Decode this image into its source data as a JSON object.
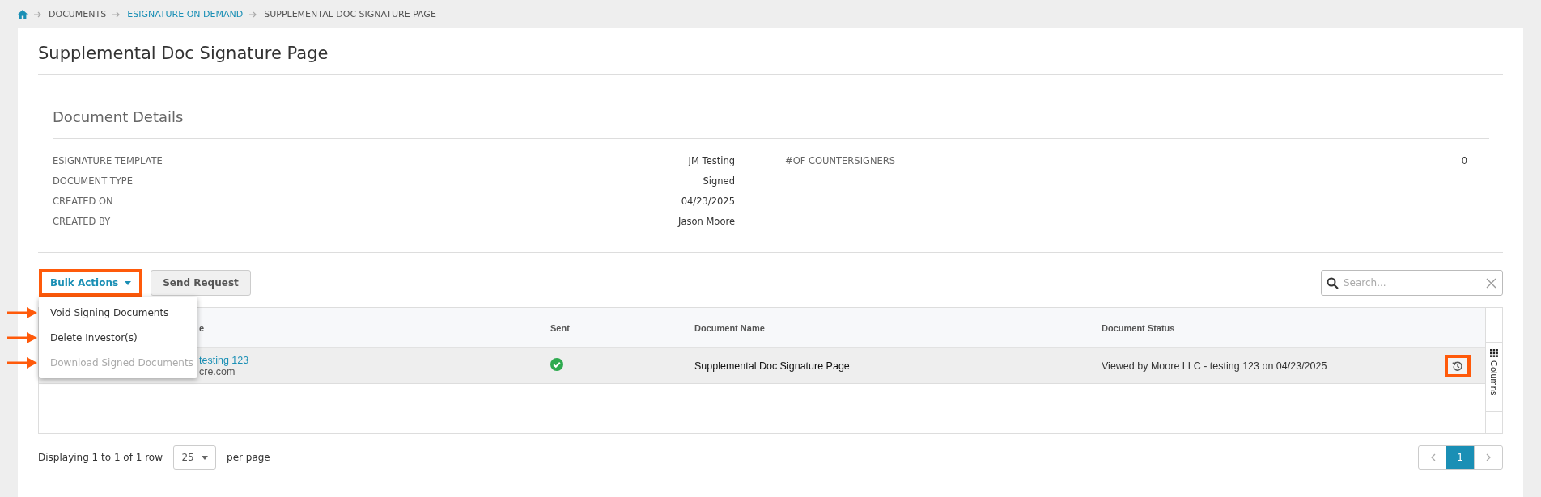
{
  "breadcrumb": [
    {
      "label": "DOCUMENTS",
      "link": false
    },
    {
      "label": "ESIGNATURE ON DEMAND",
      "link": true
    },
    {
      "label": "SUPPLEMENTAL DOC SIGNATURE PAGE",
      "link": false
    }
  ],
  "page_title": "Supplemental Doc Signature Page",
  "document_details": {
    "title": "Document Details",
    "left": [
      {
        "label": "ESIGNATURE TEMPLATE",
        "value": "JM Testing"
      },
      {
        "label": "DOCUMENT TYPE",
        "value": "Signed"
      },
      {
        "label": "CREATED ON",
        "value": "04/23/2025"
      },
      {
        "label": "CREATED BY",
        "value": "Jason Moore"
      }
    ],
    "right": [
      {
        "label": "#OF COUNTERSIGNERS",
        "value": "0"
      }
    ]
  },
  "toolbar": {
    "bulk_actions": "Bulk Actions",
    "send_request": "Send Request",
    "search": {
      "placeholder": "Search..."
    }
  },
  "bulk_menu": [
    {
      "label": "Void Signing Documents",
      "disabled": false
    },
    {
      "label": "Delete Investor(s)",
      "disabled": false
    },
    {
      "label": "Download Signed Documents",
      "disabled": true
    }
  ],
  "table": {
    "columns": [
      "e",
      "Sent",
      "Document Name",
      "Document Status"
    ],
    "rows": [
      {
        "name": "testing 123",
        "email": "cre.com",
        "sent": true,
        "document_name": "Supplemental Doc Signature Page",
        "status": "Viewed by Moore LLC - testing 123 on 04/23/2025"
      }
    ],
    "columns_button": "Columns"
  },
  "footer": {
    "display": "Displaying 1 to 1 of 1 row",
    "page_size": "25",
    "per_page": "per page",
    "pages": [
      {
        "label": "1",
        "selected": true
      }
    ]
  }
}
